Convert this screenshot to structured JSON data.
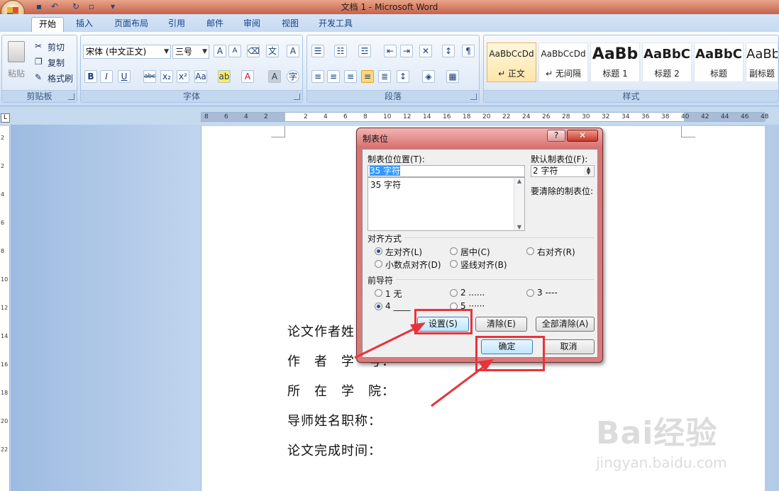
{
  "window": {
    "title": "文档 1 - Microsoft Word"
  },
  "tabs": [
    "开始",
    "插入",
    "页面布局",
    "引用",
    "邮件",
    "审阅",
    "视图",
    "开发工具"
  ],
  "clipboard": {
    "paste": "粘贴",
    "cut": "剪切",
    "copy": "复制",
    "format_painter": "格式刷",
    "label": "剪贴板"
  },
  "font": {
    "name": "宋体 (中文正文)",
    "size": "三号",
    "label": "字体"
  },
  "paragraph": {
    "label": "段落"
  },
  "styles": {
    "label": "样式",
    "items": [
      {
        "sample": "AaBbCcDd",
        "name": "↵ 正文"
      },
      {
        "sample": "AaBbCcDd",
        "name": "↵ 无间隔"
      },
      {
        "sample": "AaBb",
        "name": "标题 1"
      },
      {
        "sample": "AaBbC",
        "name": "标题 2"
      },
      {
        "sample": "AaBbC",
        "name": "标题"
      },
      {
        "sample": "AaBb",
        "name": "副标题"
      }
    ]
  },
  "ruler": {
    "ticks": [
      "8",
      "6",
      "4",
      "2",
      "",
      "2",
      "4",
      "6",
      "8",
      "10",
      "12",
      "14",
      "16",
      "18",
      "20",
      "22",
      "24",
      "26",
      "28",
      "30",
      "32",
      "34",
      "36",
      "38",
      "40",
      "42",
      "44",
      "46",
      "48"
    ],
    "corner": "L"
  },
  "vruler": {
    "ticks": [
      "2",
      "2",
      "4",
      "6",
      "8",
      "10",
      "12",
      "14",
      "16",
      "18",
      "20",
      "22"
    ]
  },
  "document": {
    "lines": [
      "论文作者姓",
      "作　者　学　号：",
      "所　在　学　院：",
      "导师姓名职称：",
      "论文完成时间："
    ]
  },
  "dialog": {
    "title": "制表位",
    "help": "?",
    "close": "✕",
    "tab_position_label": "制表位位置(T):",
    "tab_position_value": "35 字符",
    "tab_list": [
      "35 字符"
    ],
    "default_tab_label": "默认制表位(F):",
    "default_tab_value": "2 字符",
    "clear_label": "要清除的制表位:",
    "alignment_label": "对齐方式",
    "alignment_options": [
      "左对齐(L)",
      "居中(C)",
      "右对齐(R)",
      "小数点对齐(D)",
      "竖线对齐(B)"
    ],
    "alignment_selected": "左对齐(L)",
    "leader_label": "前导符",
    "leader_options": [
      "1 无",
      "2 ......",
      "3 ----",
      "4 ____",
      "5 ······"
    ],
    "leader_selected": "4 ____",
    "set_button": "设置(S)",
    "clear_button": "清除(E)",
    "clear_all_button": "全部清除(A)",
    "ok_button": "确定",
    "cancel_button": "取消"
  },
  "watermark": {
    "brand": "Bai经验",
    "url": "jingyan.baidu.com"
  },
  "colors": {
    "annotation": "#e8333b",
    "title_bar": "#c6614b",
    "dialog_frame": "#d97373"
  }
}
